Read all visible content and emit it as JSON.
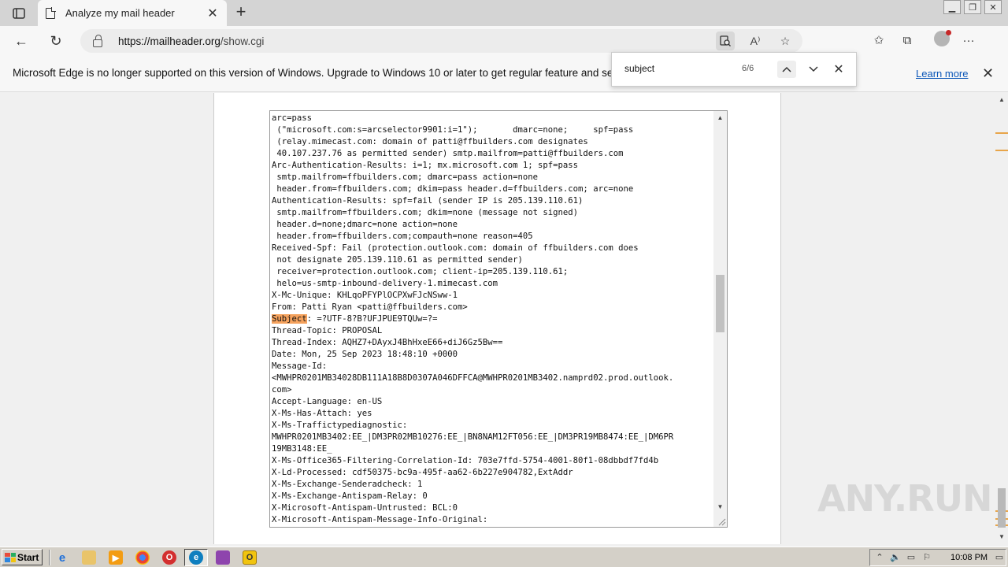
{
  "browser": {
    "tab_title": "Analyze my mail header",
    "url_host": "https://mailheader.org",
    "url_path": "/show.cgi",
    "read_aloud_label": "A⁾"
  },
  "infobar": {
    "message": "Microsoft Edge is no longer supported on this version of Windows. Upgrade to Windows 10 or later to get regular feature and security updates.",
    "link_text": "Learn more"
  },
  "find": {
    "query": "subject",
    "count": "6/6"
  },
  "header_text": {
    "before_highlight": "arc=pass\n (\"microsoft.com:s=arcselector9901:i=1\");       dmarc=none;     spf=pass\n (relay.mimecast.com: domain of patti@ffbuilders.com designates\n 40.107.237.76 as permitted sender) smtp.mailfrom=patti@ffbuilders.com\nArc-Authentication-Results: i=1; mx.microsoft.com 1; spf=pass\n smtp.mailfrom=ffbuilders.com; dmarc=pass action=none\n header.from=ffbuilders.com; dkim=pass header.d=ffbuilders.com; arc=none\nAuthentication-Results: spf=fail (sender IP is 205.139.110.61)\n smtp.mailfrom=ffbuilders.com; dkim=none (message not signed)\n header.d=none;dmarc=none action=none\n header.from=ffbuilders.com;compauth=none reason=405\nReceived-Spf: Fail (protection.outlook.com: domain of ffbuilders.com does\n not designate 205.139.110.61 as permitted sender)\n receiver=protection.outlook.com; client-ip=205.139.110.61;\n helo=us-smtp-inbound-delivery-1.mimecast.com\nX-Mc-Unique: KHLqoPFYPlOCPXwFJcNSww-1\nFrom: Patti Ryan <patti@ffbuilders.com>\n",
    "highlight": "Subject",
    "after_highlight": ": =?UTF-8?B?UFJPUE9TQUw=?=\nThread-Topic: PROPOSAL\nThread-Index: AQHZ7+DAyxJ4BhHxeE66+diJ6Gz5Bw==\nDate: Mon, 25 Sep 2023 18:48:10 +0000\nMessage-Id:\n<MWHPR0201MB34028DB111A18B8D0307A046DFFCA@MWHPR0201MB3402.namprd02.prod.outlook.\ncom>\nAccept-Language: en-US\nX-Ms-Has-Attach: yes\nX-Ms-Traffictypediagnostic:\nMWHPR0201MB3402:EE_|DM3PR02MB10276:EE_|BN8NAM12FT056:EE_|DM3PR19MB8474:EE_|DM6PR\n19MB3148:EE_\nX-Ms-Office365-Filtering-Correlation-Id: 703e7ffd-5754-4001-80f1-08dbbdf7fd4b\nX-Ld-Processed: cdf50375-bc9a-495f-aa62-6b227e904782,ExtAddr\nX-Ms-Exchange-Senderadcheck: 1\nX-Ms-Exchange-Antispam-Relay: 0\nX-Microsoft-Antispam-Untrusted: BCL:0\nX-Microsoft-Antispam-Message-Info-Original:"
  },
  "watermark": "ANY.RUN",
  "taskbar": {
    "start_label": "Start",
    "clock": "10:08 PM"
  },
  "colors": {
    "highlight": "#f5a25d",
    "link": "#0a56b8"
  }
}
